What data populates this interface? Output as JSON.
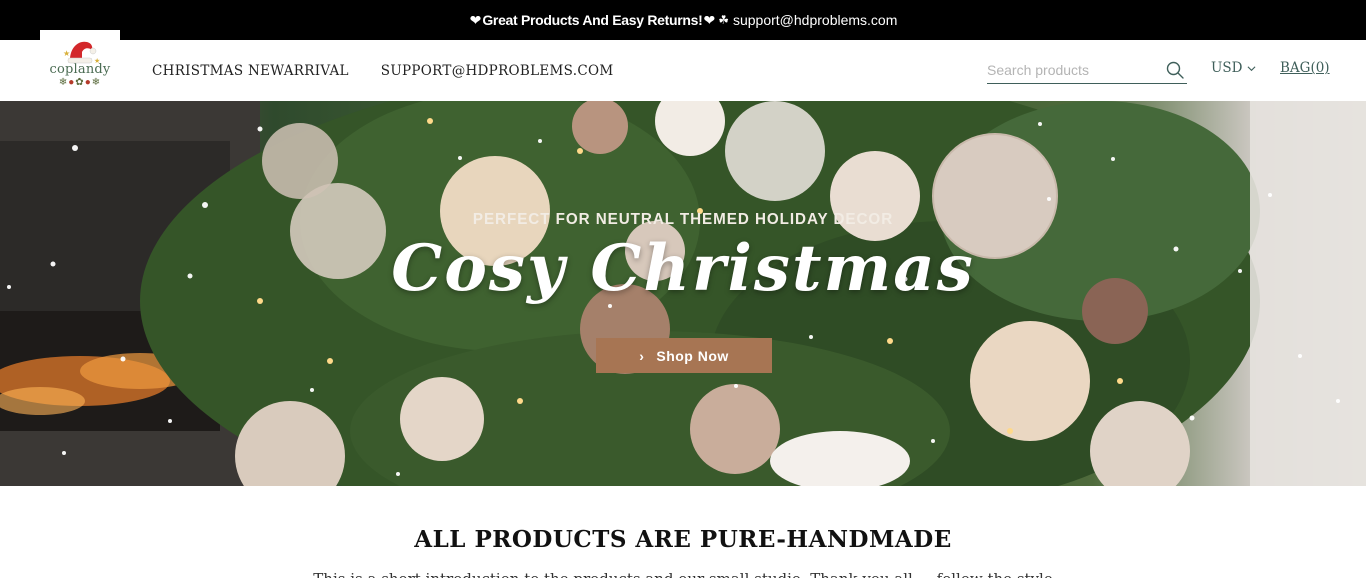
{
  "announcement": {
    "text_bold": "Great Products And Easy Returns!",
    "email": "support@hdproblems.com"
  },
  "logo": {
    "wordmark": "coplandy"
  },
  "nav": {
    "items": [
      {
        "label": "CHRISTMAS NEWARRIVAL"
      },
      {
        "label": "SUPPORT@HDPROBLEMS.COM"
      }
    ]
  },
  "search": {
    "placeholder": "Search products",
    "value": ""
  },
  "currency": {
    "selected": "USD"
  },
  "bag": {
    "label": "BAG(0)"
  },
  "hero": {
    "subtitle": "PERFECT FOR NEUTRAL THEMED HOLIDAY DECOR",
    "title": "Cosy Christmas",
    "button_label": "Shop Now"
  },
  "section": {
    "title": "ALL PRODUCTS ARE PURE-HANDMADE",
    "text": "This is a short introduction to the products and our small studio. Thank you all ... follow the style"
  },
  "colors": {
    "announce_bg": "#000000",
    "accent": "#3f5f5a",
    "button": "#a77553"
  }
}
